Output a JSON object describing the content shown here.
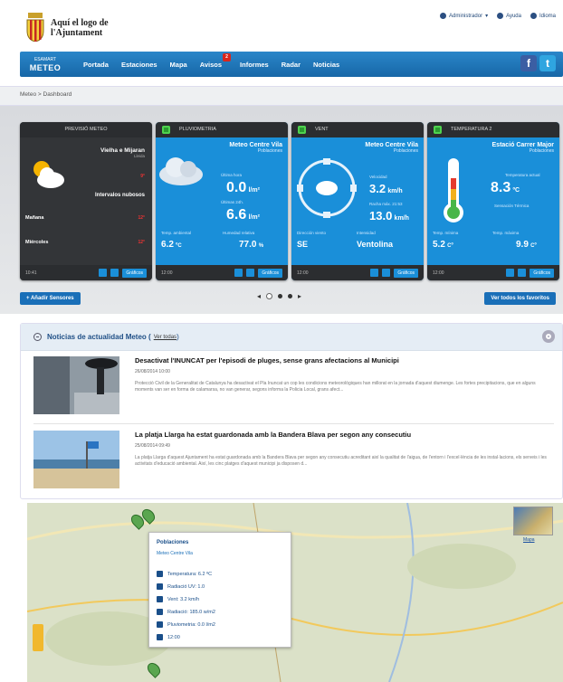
{
  "header": {
    "logo_line1": "Aquí el logo de",
    "logo_line2": "l'Ajuntament",
    "links": [
      "Administrador",
      "Ayuda",
      "Idioma"
    ]
  },
  "nav": {
    "brand_top": "ESAMART",
    "brand": "METEO",
    "items": [
      "Portada",
      "Estaciones",
      "Mapa",
      "Avisos",
      "Informes",
      "Radar",
      "Noticias"
    ],
    "avisos_badge": "2",
    "social": [
      "f",
      "t"
    ]
  },
  "breadcrumb": {
    "home": "Meteo",
    "sep": ">",
    "current": "Dashboard"
  },
  "cards": [
    {
      "title": "PREVISIÓ METEO",
      "city": "Vielha e Mijaran",
      "region": "Lleida",
      "desc": "Intervalos nubosos",
      "temp_now": "9°",
      "rows": [
        {
          "day": "Mañana",
          "temp": "12°"
        },
        {
          "day": "Miércoles",
          "temp": "12°"
        }
      ],
      "time": "10:41",
      "button": "Gráficos"
    },
    {
      "title": "PLUVIOMETRIA",
      "station": "Meteo Centre Vila",
      "region": "Poblaciones",
      "l1": "Última hora",
      "v1": "0.0",
      "u1": "l/m²",
      "l2": "Últimas 24h.",
      "v2": "6.6",
      "u2": "l/m²",
      "bl1": "Temp. ambiental",
      "bv1": "6.2",
      "bu1": "ºC",
      "bl2": "Humedad relativa",
      "bv2": "77.0",
      "bu2": "%",
      "time": "12:00",
      "button": "Gráficos"
    },
    {
      "title": "VENT",
      "station": "Meteo Centre Vila",
      "region": "Poblaciones",
      "l1": "Velocidad",
      "v1": "3.2",
      "u1": "km/h",
      "l2": "Racha máx. 21:53",
      "v2": "13.0",
      "u2": "km/h",
      "bl1": "Dirección viento",
      "bv1": "SE",
      "bl2": "Intensidad",
      "bv2": "Ventolina",
      "time": "12:00",
      "button": "Gráficos"
    },
    {
      "title": "TEMPERATURA 2",
      "station": "Estació Carrer Major",
      "region": "Poblaciones",
      "l1": "Temperatura actual",
      "v1": "8.3",
      "u1": "ºC",
      "l2": "Sensación Térmica",
      "bl1": "Temp. mínima",
      "bv1": "5.2",
      "bu1": "Cº",
      "bl2": "Temp. máxima",
      "bv2": "9.9",
      "bu2": "Cº",
      "time": "12:00",
      "button": "Gráficos"
    }
  ],
  "actions": {
    "add": "+ Añadir Sensores",
    "favs": "Ver todos los favoritos"
  },
  "news": {
    "title": "Noticias de actualidad Meteo",
    "view_all": "Ver todas",
    "items": [
      {
        "title": "Desactivat l'INUNCAT per l'episodi de pluges, sense grans afectacions al Municipi",
        "date": "26/08/2014 10:00",
        "body": "Protecció Civil de la Generalitat de Catalunya ha desactivat el Pla Inuncat un cop les condicions meteorològiques han millorat en la jornada d'aquest diumenge. Les fortes precipitacions, que en alguns moments van ser en forma de calamarsa, no van generar, segons informa la Policia Local, grans afect..."
      },
      {
        "title": "La platja Llarga ha estat guardonada amb la Bandera Blava per segon any consecutiu",
        "date": "25/08/2014 09:49",
        "body": "La platja Llarga d'aquest Ajuntament ha estat guardonada amb la Bandera Blava per segon any consecutiu acreditant així la qualitat de l'aigua, de l'entorn i l'excel·lència de les instal·lacions, els serveis i les activitats d'educació ambiental. Així, les cinc platges d'aquest municipi ja disposen d..."
      }
    ]
  },
  "map": {
    "thumb_label": "Mapa",
    "popup": {
      "title": "Poblaciones",
      "station": "Meteo Centre Vila",
      "rows": [
        "Temperatura: 6.2 ºC",
        "Radiació UV: 1.0",
        "Vent: 3.2 km/h",
        "Radiació: 185.0 w/m2",
        "Pluviometria: 0.0 l/m2",
        "12:00"
      ]
    }
  }
}
